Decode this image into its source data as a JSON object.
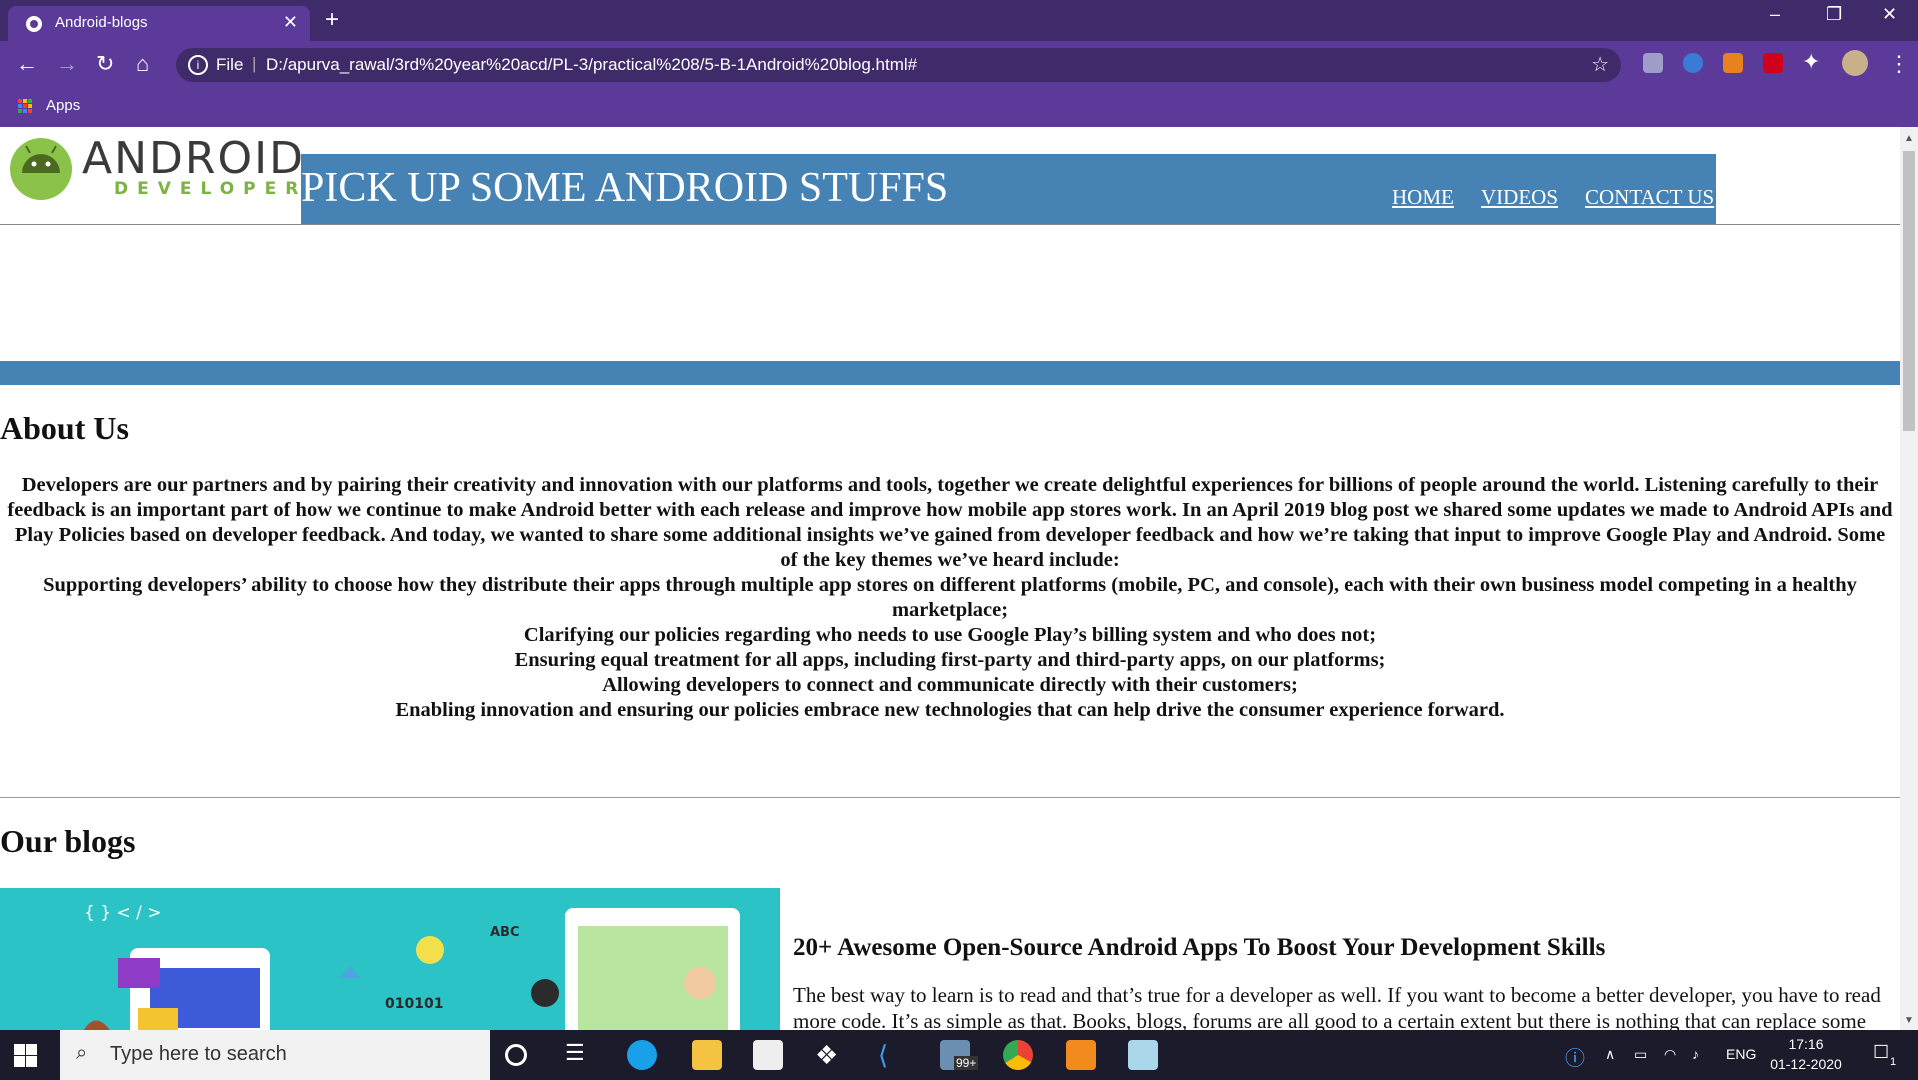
{
  "browser": {
    "tab_title": "Android-blogs",
    "tab_close": "✕",
    "new_tab": "+",
    "scheme": "File",
    "url": "D:/apurva_rawal/3rd%20year%20acd/PL-3/practical%208/5-B-1Android%20blog.html#",
    "bookmark_apps": "Apps"
  },
  "site": {
    "logo_word": "ANDROID",
    "logo_sub": "DEVELOPER",
    "header_title": "PICK UP SOME ANDROID STUFFS",
    "nav": [
      "HOME",
      "VIDEOS",
      "CONTACT US"
    ]
  },
  "about": {
    "heading": "About Us",
    "lines": [
      "Developers are our partners and by pairing their creativity and innovation with our platforms and tools, together we create delightful experiences for billions of people around the world. Listening carefully to their feedback is an important part of how we continue to make Android better with each release and improve how mobile app stores work. In an April 2019 blog post we shared some updates we made to Android APIs and Play Policies based on developer feedback. And today, we wanted to share some additional insights we’ve gained from developer feedback and how we’re taking that input to improve Google Play and Android. Some of the key themes we’ve heard include:",
      "Supporting developers’ ability to choose how they distribute their apps through multiple app stores on different platforms (mobile, PC, and console), each with their own business model competing in a healthy marketplace;",
      "Clarifying our policies regarding who needs to use Google Play’s billing system and who does not;",
      "Ensuring equal treatment for all apps, including first-party and third-party apps, on our platforms;",
      "Allowing developers to connect and communicate directly with their customers;",
      "Enabling innovation and ensuring our policies embrace new technologies that can help drive the consumer experience forward."
    ]
  },
  "blogs": {
    "heading": "Our blogs",
    "image_labels": [
      "{ } < / >",
      "ABC",
      "010101"
    ],
    "post_title": "20+ Awesome Open-Source Android Apps To Boost Your Development Skills",
    "post_text": "The best way to learn is to read and that’s true for a developer as well. If you want to become a better developer, you have to read more code. It’s as simple as that. Books, blogs, forums are all good to a certain extent but there is nothing that can replace some"
  },
  "taskbar": {
    "search_placeholder": "Type here to search",
    "mail_badge": "99+",
    "lang": "ENG",
    "time": "17:16",
    "date": "01-12-2020",
    "notif_count": "1"
  },
  "colors": {
    "chrome_dark": "#3f2a6a",
    "chrome": "#5b3a9a",
    "header_blue": "#4682b4",
    "android_green": "#8bc34a"
  }
}
